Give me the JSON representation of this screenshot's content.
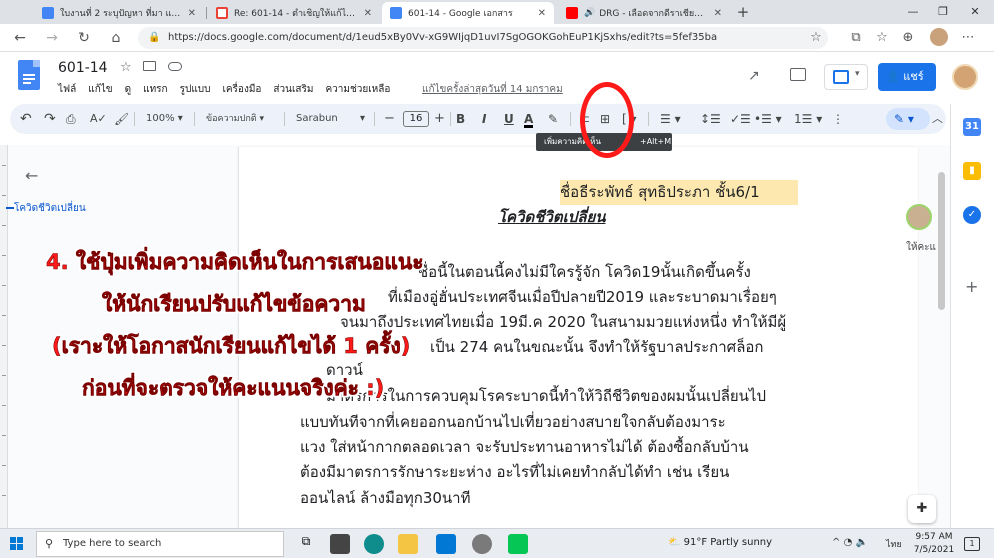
{
  "browser": {
    "tabs": [
      {
        "label": "ใบงานที่ 2 ระบุปัญหา ที่มา แหล่งข้อมูล",
        "favicon": "#4285f4"
      },
      {
        "label": "Re: 601-14 - ตำเชิญให้แก้ไข - piya...",
        "favicon": "#ea4335"
      },
      {
        "label": "601-14 - Google เอกสาร",
        "favicon": "#4285f4"
      },
      {
        "label": "DRG - เลือดจากดีราเชียน feat...",
        "favicon": "#ff0000"
      }
    ],
    "new_tab": "+",
    "url": "https://docs.google.com/document/d/1eud5xBy0Vv-xG9WIjqD1uvI7SgOGOKGohEuP1KjSxhs/edit?ts=5fef35ba"
  },
  "docs": {
    "title": "601-14",
    "menu": [
      "ไฟล์",
      "แก้ไข",
      "ดู",
      "แทรก",
      "รูปแบบ",
      "เครื่องมือ",
      "ส่วนเสริม",
      "ความช่วยเหลือ"
    ],
    "last_edit": "แก้ไขครั้งล่าสุดวันที่ 14 มกราคม",
    "share_label": "แชร์",
    "toolbar": {
      "zoom": "100%",
      "style": "ข้อความปกติ",
      "font": "Sarabun",
      "font_size": "16",
      "bold": "B",
      "italic": "I",
      "underline": "U",
      "text_color": "A"
    },
    "tooltip": {
      "text": "เพิ่มความคิดเห็น",
      "keys": "+Alt+M)"
    },
    "outline_item": "โควิดชีวิตเปลี่ยน",
    "author_line": "ชื่อธีระพัทธ์ สุทธิประภา      ชั้น6/1",
    "heading": "โควิดชีวิตเปลี่ยน",
    "paragraph_lines": [
      "ชื่อนี้ในตอนนี้คงไม่มีใครรู้จัก โควิด19นั้นเกิดขึ้นครั้ง",
      "ที่เมืองอู่ฮั่นประเทศจีนเมื่อปีปลายปี2019 และระบาดมาเรื่อยๆ",
      "จนมาถึงประเทศไทยเมื่อ 19มี.ค 2020 ในสนามมวยแห่งหนึ่ง ทำให้มีผู้",
      "เป็น 274 คนในขณะนั้น จึงทำให้รัฐบาลประกาศล็อก",
      "ดาวน์",
      "มาตรการในการควบคุมโรคระบาดนี้ทำให้วิถีชีวิตของผมนั้นเปลี่ยนไป",
      "แบบทันทีจากที่เคยออกนอกบ้านไปเที่ยวอย่างสบายใจกลับต้องมาระ",
      "แวง ใส่หน้ากากตลอดเวลา จะรับประทานอาหารไม่ได้ ต้องซื้อกลับบ้าน",
      "ต้องมีมาตรการรักษาระยะห่าง อะไรที่ไม่เคยทำกลับได้ทำ เช่น เรียน",
      "ออนไลน์ ล้างมือทุก30นาที"
    ],
    "annotation": [
      "4. ใช้ปุ่มเพิ่มความคิดเห็นในการเสนอแนะ",
      "ให้นักเรียนปรับแก้ไขข้อความ",
      "(เราะให้โอกาสนักเรียนแก้ไขได้ 1 ครั้ง)",
      "ก่อนที่จะตรวจให้คะแนนจริงค่ะ :)"
    ],
    "comment_label": "ให้คะแ"
  },
  "taskbar": {
    "search_placeholder": "Type here to search",
    "weather": "91°F  Partly sunny",
    "lang": "ไทย",
    "time": "9:57 AM",
    "date": "7/5/2021",
    "notifications": "1"
  },
  "colors": {
    "accent": "#1a73e8",
    "annotation": "#ff1a1a",
    "author_highlight": "#fde9b0"
  }
}
